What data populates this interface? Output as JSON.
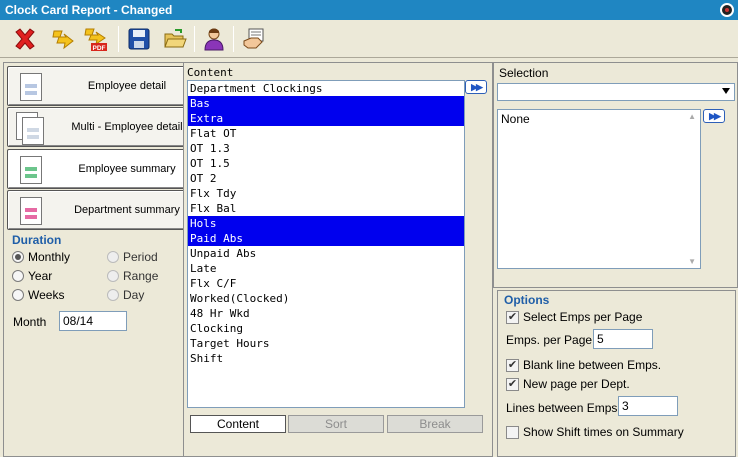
{
  "window": {
    "title": "Clock Card Report - Changed"
  },
  "toolbar": {
    "buttons": [
      {
        "name": "close-report",
        "icon": "red-x-icon"
      },
      {
        "name": "run-report",
        "icon": "lightning-arrow-icon"
      },
      {
        "name": "pdf-report",
        "icon": "pdf-arrow-icon",
        "badge": "PDF"
      },
      {
        "name": "save",
        "icon": "floppy-disk-icon"
      },
      {
        "name": "open",
        "icon": "open-folder-icon"
      },
      {
        "name": "user",
        "icon": "person-icon"
      },
      {
        "name": "edit",
        "icon": "hand-document-icon"
      }
    ]
  },
  "report_types": [
    {
      "label": "Employee detail",
      "icon": "document-icon",
      "color": "#b7c7e2",
      "selected": false
    },
    {
      "label": "Multi - Employee detail",
      "icon": "multi-document-icon",
      "color": "#cfd8e4",
      "selected": false
    },
    {
      "label": "Employee summary",
      "icon": "summary-document-icon",
      "color": "#6cc58c",
      "selected": true
    },
    {
      "label": "Department summary",
      "icon": "department-document-icon",
      "color": "#e66aa4",
      "selected": false
    }
  ],
  "duration": {
    "title": "Duration",
    "options": [
      {
        "label": "Monthly",
        "checked": true,
        "enabled": true
      },
      {
        "label": "Period",
        "checked": false,
        "enabled": false
      },
      {
        "label": "Year",
        "checked": false,
        "enabled": true
      },
      {
        "label": "Range",
        "checked": false,
        "enabled": false
      },
      {
        "label": "Weeks",
        "checked": false,
        "enabled": true
      },
      {
        "label": "Day",
        "checked": false,
        "enabled": false
      }
    ],
    "month_label": "Month",
    "month_value": "08/14"
  },
  "content": {
    "label": "Content",
    "arrow": "▶▶",
    "items": [
      {
        "text": "Department Clockings",
        "highlighted": false
      },
      {
        "text": "Bas",
        "highlighted": true
      },
      {
        "text": "Extra",
        "highlighted": true
      },
      {
        "text": "Flat OT",
        "highlighted": false
      },
      {
        "text": "OT 1.3",
        "highlighted": false
      },
      {
        "text": "OT 1.5",
        "highlighted": false
      },
      {
        "text": "OT 2",
        "highlighted": false
      },
      {
        "text": "Flx Tdy",
        "highlighted": false
      },
      {
        "text": "Flx Bal",
        "highlighted": false
      },
      {
        "text": "Hols",
        "highlighted": true
      },
      {
        "text": "Paid Abs",
        "highlighted": true
      },
      {
        "text": "Unpaid Abs",
        "highlighted": false
      },
      {
        "text": "Late",
        "highlighted": false
      },
      {
        "text": "Flx C/F",
        "highlighted": false
      },
      {
        "text": "Worked(Clocked)",
        "highlighted": false
      },
      {
        "text": "48 Hr Wkd",
        "highlighted": false
      },
      {
        "text": "Clocking",
        "highlighted": false
      },
      {
        "text": "Target Hours",
        "highlighted": false
      },
      {
        "text": "Shift",
        "highlighted": false
      }
    ],
    "tabs": [
      {
        "label": "Content",
        "active": true
      },
      {
        "label": "Sort",
        "active": false
      },
      {
        "label": "Break",
        "active": false
      }
    ]
  },
  "selection": {
    "label": "Selection",
    "dropdown_value": "",
    "arrow": "▶▶",
    "list": [
      "None"
    ]
  },
  "options": {
    "title": "Options",
    "select_emps_per_page": {
      "label": "Select Emps per Page",
      "checked": true
    },
    "emps_per_page": {
      "label": "Emps. per Page",
      "value": "5"
    },
    "blank_line": {
      "label": "Blank line between Emps.",
      "checked": true
    },
    "new_page": {
      "label": "New page per Dept.",
      "checked": true
    },
    "lines_between": {
      "label": "Lines between Emps",
      "value": "3"
    },
    "show_shift": {
      "label": "Show Shift times on Summary",
      "checked": false
    }
  }
}
